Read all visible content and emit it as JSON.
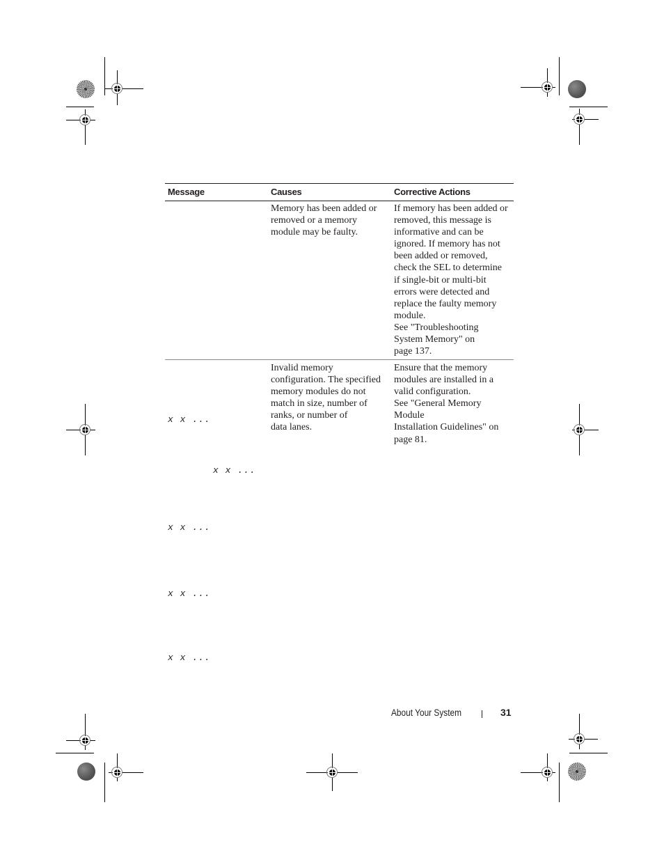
{
  "table": {
    "headers": [
      "Message",
      "Causes",
      "Corrective Actions"
    ],
    "rows": [
      {
        "message": "",
        "causes": "Memory has been added or\nremoved or a memory\nmodule may be faulty.",
        "actions": "If memory has been added or\nremoved, this message is\ninformative and can be\nignored. If memory has not\nbeen added or removed,\ncheck the SEL to determine\nif single-bit or multi-bit\nerrors were detected and\nreplace the faulty memory\nmodule.\nSee \"Troubleshooting\nSystem Memory\" on\npage 137."
      },
      {
        "message": "x x ...",
        "causes": "Invalid memory\nconfiguration. The specified\nmemory modules do not\nmatch in size, number of\nranks, or number of\ndata lanes.",
        "actions": "Ensure that the memory\nmodules are installed in a\nvalid configuration.\nSee \"General Memory\nModule\nInstallation Guidelines\" on\npage 81."
      }
    ]
  },
  "loose_fragments": [
    "x x ...",
    "x x ...",
    "x x ...",
    "x x ..."
  ],
  "footer": {
    "section_title": "About Your System",
    "page_number": "31"
  }
}
